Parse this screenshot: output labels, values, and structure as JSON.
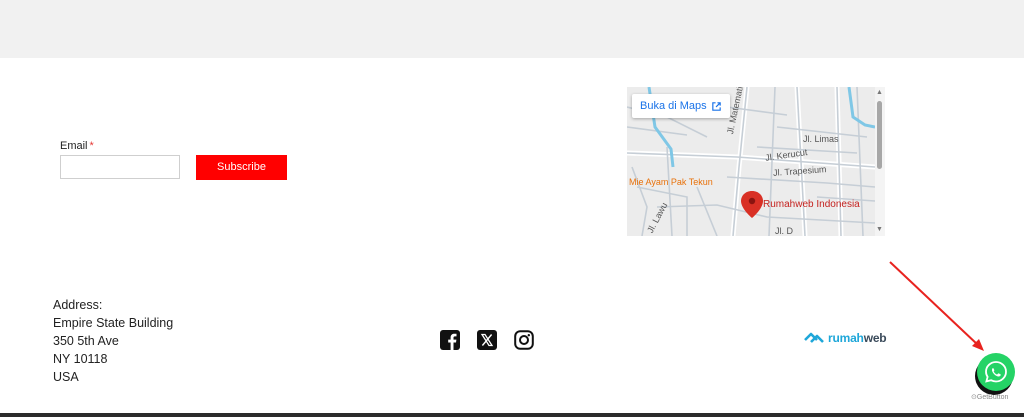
{
  "newsletter": {
    "email_label": "Email",
    "required_mark": "*",
    "email_value": "",
    "subscribe_label": "Subscribe"
  },
  "map": {
    "open_label": "Buka di Maps",
    "streets": [
      "Jl. Matematika",
      "Jl. Limas",
      "Jl. Kerucut",
      "Jl. Trapesium",
      "Jl. Lawu",
      "Jl. D"
    ],
    "poi": "Mie Ayam Pak Tekun",
    "place": "Rumahweb Indonesia",
    "colors": {
      "road": "#c6ced6",
      "water": "#7fc7e6",
      "pin": "#d93025",
      "link": "#1a73e8"
    }
  },
  "address": {
    "lines": [
      "Address:",
      "Empire State Building",
      "350 5th Ave",
      "NY 10118",
      "USA"
    ]
  },
  "social": {
    "icons": [
      "facebook-icon",
      "x-icon",
      "instagram-icon"
    ]
  },
  "brand": {
    "part1": "rumah",
    "part2": "web",
    "colors": {
      "primary": "#1fa7d9",
      "secondary": "#3a4a5a"
    }
  },
  "whatsapp": {
    "credit": "GetButton",
    "color": "#25d366"
  },
  "annotation": {
    "arrow_color": "#e8231f"
  }
}
